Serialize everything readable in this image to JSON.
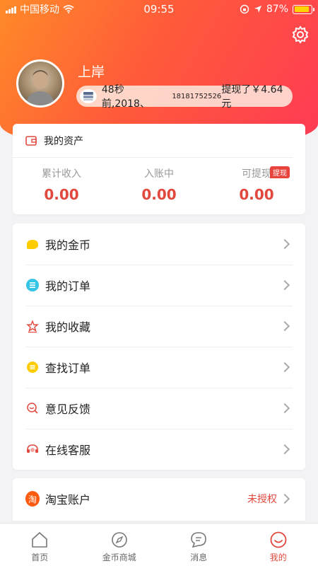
{
  "status_bar": {
    "carrier": "中国移动",
    "time": "09:55",
    "battery_percent": "87%",
    "battery_level": 0.87
  },
  "profile": {
    "username": "上岸",
    "ticker": {
      "prefix": "48秒前,2018、",
      "phone": "18181752526",
      "suffix": "提现了￥4.64元"
    }
  },
  "assets": {
    "title": "我的资产",
    "columns": [
      {
        "label": "累计收入",
        "value": "0.00"
      },
      {
        "label": "入账中",
        "value": "0.00"
      },
      {
        "label": "可提现",
        "value": "0.00",
        "badge": "提现"
      }
    ]
  },
  "menu": {
    "items": [
      {
        "label": "我的金币",
        "icon": "coin-icon"
      },
      {
        "label": "我的订单",
        "icon": "order-icon"
      },
      {
        "label": "我的收藏",
        "icon": "favorite-icon"
      },
      {
        "label": "查找订单",
        "icon": "find-order-icon"
      },
      {
        "label": "意见反馈",
        "icon": "feedback-icon"
      },
      {
        "label": "在线客服",
        "icon": "customer-service-icon"
      }
    ]
  },
  "taobao": {
    "icon_text": "淘",
    "label": "淘宝账户",
    "status": "未授权"
  },
  "tabbar": {
    "tabs": [
      {
        "label": "首页",
        "icon": "home-icon"
      },
      {
        "label": "金币商城",
        "icon": "compass-icon"
      },
      {
        "label": "消息",
        "icon": "message-icon"
      },
      {
        "label": "我的",
        "icon": "smile-icon",
        "active": true
      }
    ]
  },
  "colors": {
    "accent": "#e2483d",
    "gradient_start": "#ff8a28",
    "gradient_end": "#ff3a55"
  }
}
